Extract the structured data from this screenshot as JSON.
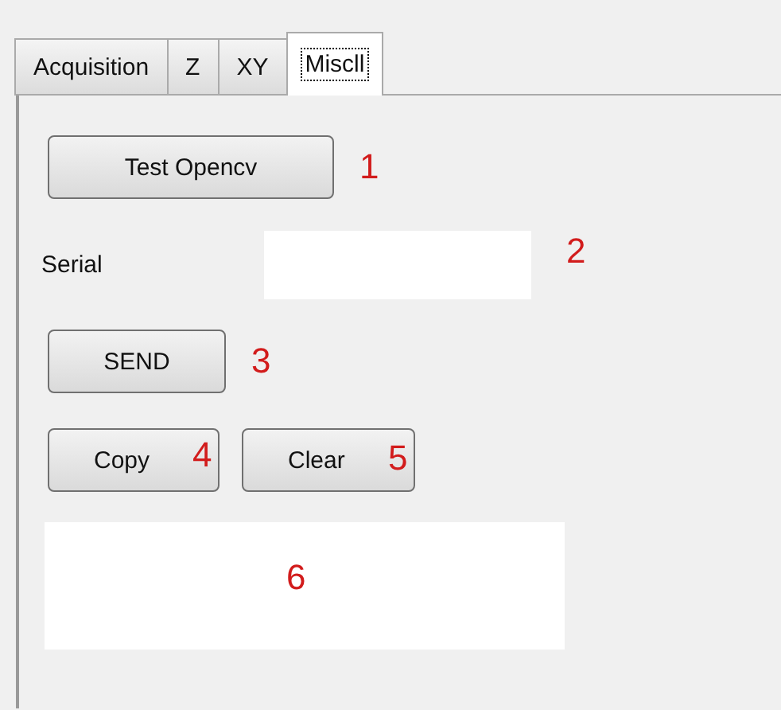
{
  "tabs": [
    {
      "label": "Acquisition",
      "selected": false
    },
    {
      "label": "Z",
      "selected": false
    },
    {
      "label": "XY",
      "selected": false
    },
    {
      "label": "Miscll",
      "selected": true
    }
  ],
  "test_button": {
    "label": "Test Opencv",
    "annotation": "1"
  },
  "serial": {
    "label": "Serial",
    "annotation": "2"
  },
  "send_button": {
    "label": "SEND",
    "annotation": "3"
  },
  "copy_button": {
    "label": "Copy",
    "annotation": "4"
  },
  "clear_button": {
    "label": "Clear",
    "annotation": "5"
  },
  "output_box": {
    "annotation": "6"
  }
}
